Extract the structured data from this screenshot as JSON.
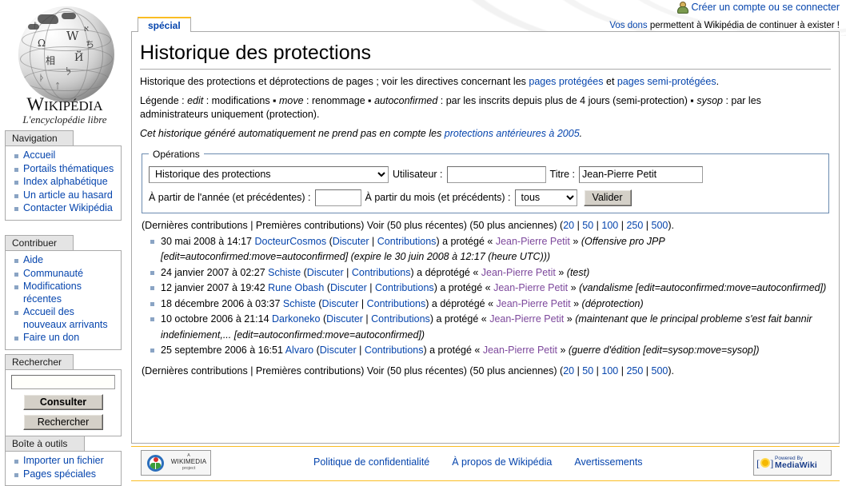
{
  "header": {
    "account_link": "Créer un compte ou se connecter",
    "account_icon": "user-icon",
    "donate_link": "Vos dons",
    "donate_rest": " permettent à Wikipédia de continuer à exister !"
  },
  "logo": {
    "wordmark_w": "W",
    "wordmark_rest": "IKIPÉDIA",
    "tagline": "L'encyclopédie libre"
  },
  "sidebar": {
    "portlets": [
      {
        "title": "Navigation",
        "items": [
          "Accueil",
          "Portails thématiques",
          "Index alphabétique",
          "Un article au hasard",
          "Contacter Wikipédia"
        ]
      },
      {
        "title": "Contribuer",
        "items": [
          "Aide",
          "Communauté",
          "Modifications récentes",
          "Accueil des nouveaux arrivants",
          "Faire un don"
        ]
      }
    ],
    "search": {
      "title": "Rechercher",
      "value": "",
      "placeholder": "",
      "go_label": "Consulter",
      "search_label": "Rechercher"
    },
    "toolbox": {
      "title": "Boîte à outils",
      "items": [
        "Importer un fichier",
        "Pages spéciales"
      ]
    }
  },
  "tabs": [
    {
      "label": "spécial",
      "selected": true
    }
  ],
  "main": {
    "title": "Historique des protections",
    "intro": {
      "p1_a": "Historique des protections et déprotections de pages ; voir les directives concernant les ",
      "p1_link1": "pages protégées",
      "p1_b": " et ",
      "p1_link2": "pages semi-protégées",
      "p1_c": ".",
      "p2_a": "Légende : ",
      "p2_edit": "edit",
      "p2_b": " : modifications ▪ ",
      "p2_move": "move",
      "p2_c": " : renommage ▪ ",
      "p2_autoconfirmed": "autoconfirmed",
      "p2_d": " : par les inscrits depuis plus de 4 jours (semi-protection) ▪ ",
      "p2_sysop": "sysop",
      "p2_e": " : par les administrateurs uniquement (protection).",
      "p3_a": "Cet historique généré automatiquement ne prend pas en compte les ",
      "p3_link": "protections antérieures à 2005",
      "p3_b": "."
    },
    "operations": {
      "legend": "Opérations",
      "action_selected": "Historique des protections",
      "action_options": [
        "Historique des protections"
      ],
      "user_label": "Utilisateur :",
      "user_value": "",
      "title_label": "Titre :",
      "title_value": "Jean-Pierre Petit",
      "year_label": "À partir de l'année (et précédentes) :",
      "year_value": "",
      "month_label": "À partir du mois (et précédents) :",
      "month_selected": "tous",
      "month_options": [
        "tous"
      ],
      "submit_label": "Valider"
    },
    "pager": {
      "prefix": "(",
      "last_contribs": "Dernières contributions",
      "sep1": " | ",
      "first_contribs": "Premières contributions",
      "mid": ") Voir (",
      "newer": "50 plus récentes",
      "mid2": ") (",
      "older": "50 plus anciennes",
      "mid3": ") (",
      "counts": [
        "20",
        "50",
        "100",
        "250",
        "500"
      ],
      "suffix": ")."
    },
    "log_entries": [
      {
        "timestamp": "30 mai 2008 à 14:17",
        "user": "DocteurCosmos",
        "talk": "Discuter",
        "contribs": "Contributions",
        "action": " a protégé « ",
        "page": "Jean-Pierre Petit",
        "page_close": " » ",
        "comment": "(Offensive pro JPP [edit=autoconfirmed:move=autoconfirmed] (expire le 30 juin 2008 à 12:17 (heure UTC)))"
      },
      {
        "timestamp": "24 janvier 2007 à 02:27",
        "user": "Schiste",
        "talk": "Discuter",
        "contribs": "Contributions",
        "action": " a déprotégé « ",
        "page": "Jean-Pierre Petit",
        "page_close": " » ",
        "comment": "(test)"
      },
      {
        "timestamp": "12 janvier 2007 à 19:42",
        "user": "Rune Obash",
        "talk": "Discuter",
        "contribs": "Contributions",
        "action": " a protégé « ",
        "page": "Jean-Pierre Petit",
        "page_close": " » ",
        "comment": "(vandalisme [edit=autoconfirmed:move=autoconfirmed])"
      },
      {
        "timestamp": "18 décembre 2006 à 03:37",
        "user": "Schiste",
        "talk": "Discuter",
        "contribs": "Contributions",
        "action": " a déprotégé « ",
        "page": "Jean-Pierre Petit",
        "page_close": " » ",
        "comment": "(déprotection)"
      },
      {
        "timestamp": "10 octobre 2006 à 21:14",
        "user": "Darkoneko",
        "talk": "Discuter",
        "contribs": "Contributions",
        "action": " a protégé « ",
        "page": "Jean-Pierre Petit",
        "page_close": " » ",
        "comment": "(maintenant que le principal probleme s'est fait bannir indefiniement,... [edit=autoconfirmed:move=autoconfirmed])"
      },
      {
        "timestamp": "25 septembre 2006 à 16:51",
        "user": "Alvaro",
        "talk": "Discuter",
        "contribs": "Contributions",
        "action": " a protégé « ",
        "page": "Jean-Pierre Petit",
        "page_close": " » ",
        "comment": "(guerre d'édition [edit=sysop:move=sysop])"
      }
    ]
  },
  "footer": {
    "links": [
      "Politique de confidentialité",
      "À propos de Wikipédia",
      "Avertissements"
    ],
    "wikimedia": {
      "a": "A",
      "name": "WIKIMEDIA",
      "project": "project"
    },
    "mediawiki": {
      "powered": "Powered By",
      "name": "MediaWiki"
    }
  },
  "colors": {
    "link": "#0645ad",
    "visited_link": "#7d489c",
    "tab_accent": "#fabd23",
    "bullet": "#8aa4c4",
    "fieldset_border": "#6b8bb0"
  }
}
